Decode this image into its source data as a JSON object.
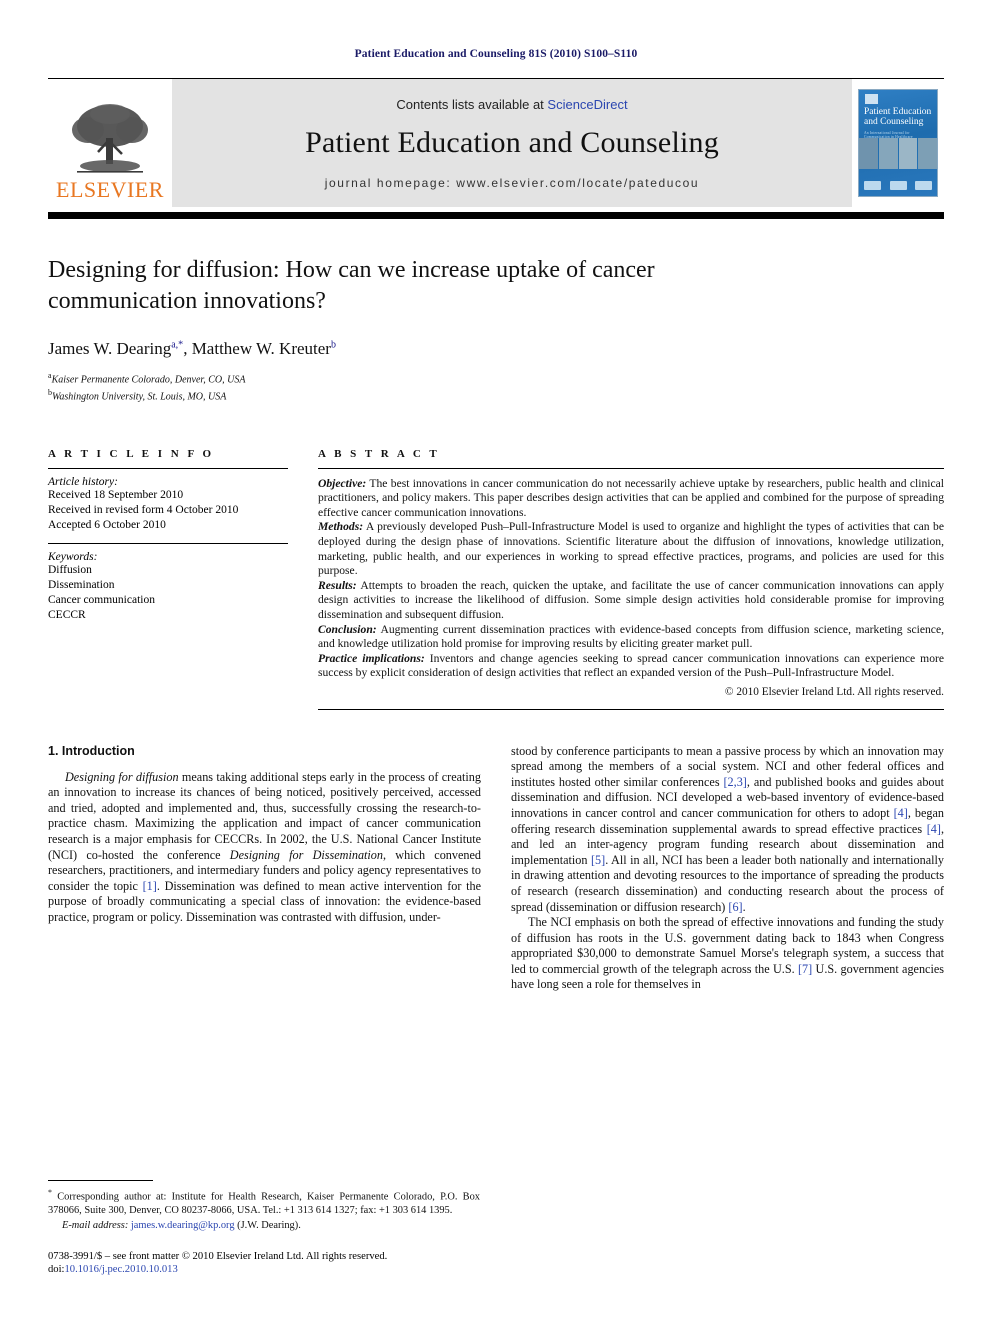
{
  "running_head": "Patient Education and Counseling 81S (2010) S100–S110",
  "masthead": {
    "publisher": "ELSEVIER",
    "contents_prefix": "Contents lists available at ",
    "contents_link": "ScienceDirect",
    "journal_title": "Patient Education and Counseling",
    "homepage": "journal homepage: www.elsevier.com/locate/pateducou",
    "cover": {
      "title_line1": "Patient Education",
      "title_line2": "and Counseling",
      "subtitle": "An International Journal for Communication in Healthcare"
    }
  },
  "article": {
    "title": "Designing for diffusion: How can we increase uptake of cancer communication innovations?",
    "authors": "James W. Dearing, Matthew W. Kreuter",
    "author1_name": "James W. Dearing",
    "author1_marks": "a,*",
    "author2_name": "Matthew W. Kreuter",
    "author2_marks": "b",
    "affiliation_a_mark": "a",
    "affiliation_a": "Kaiser Permanente Colorado, Denver, CO, USA",
    "affiliation_b_mark": "b",
    "affiliation_b": "Washington University, St. Louis, MO, USA"
  },
  "info": {
    "label": "A R T I C L E    I N F O",
    "history_label": "Article history:",
    "received": "Received 18 September 2010",
    "revised": "Received in revised form 4 October 2010",
    "accepted": "Accepted 6 October 2010",
    "keywords_label": "Keywords:",
    "keywords": [
      "Diffusion",
      "Dissemination",
      "Cancer communication",
      "CECCR"
    ]
  },
  "abstract": {
    "label": "A B S T R A C T",
    "objective_label": "Objective:",
    "objective_text": " The best innovations in cancer communication do not necessarily achieve uptake by researchers, public health and clinical practitioners, and policy makers. This paper describes design activities that can be applied and combined for the purpose of spreading effective cancer communication innovations.",
    "methods_label": "Methods:",
    "methods_text": " A previously developed Push–Pull-Infrastructure Model is used to organize and highlight the types of activities that can be deployed during the design phase of innovations. Scientific literature about the diffusion of innovations, knowledge utilization, marketing, public health, and our experiences in working to spread effective practices, programs, and policies are used for this purpose.",
    "results_label": "Results:",
    "results_text": " Attempts to broaden the reach, quicken the uptake, and facilitate the use of cancer communication innovations can apply design activities to increase the likelihood of diffusion. Some simple design activities hold considerable promise for improving dissemination and subsequent diffusion.",
    "conclusion_label": "Conclusion:",
    "conclusion_text": " Augmenting current dissemination practices with evidence-based concepts from diffusion science, marketing science, and knowledge utilization hold promise for improving results by eliciting greater market pull.",
    "practice_label": "Practice implications:",
    "practice_text": " Inventors and change agencies seeking to spread cancer communication innovations can experience more success by explicit consideration of design activities that reflect an expanded version of the Push–Pull-Infrastructure Model.",
    "copyright": "© 2010 Elsevier Ireland Ltd. All rights reserved."
  },
  "body": {
    "section1_heading": "1. Introduction",
    "left_para1_lead": "Designing for diffusion",
    "left_para1_rest": " means taking additional steps early in the process of creating an innovation to increase its chances of being noticed, positively perceived, accessed and tried, adopted and implemented and, thus, successfully crossing the research-to-practice chasm. Maximizing the application and impact of cancer communication research is a major emphasis for CECCRs. In 2002, the U.S. National Cancer Institute (NCI) co-hosted the conference ",
    "left_para1_italic2": "Designing for Dissemination",
    "left_para1_rest2": ", which convened researchers, practitioners, and intermediary funders and policy agency representatives to consider the topic ",
    "left_cite1": "[1]",
    "left_para1_rest3": ". Dissemination was defined to mean active intervention for the purpose of broadly communicating a special class of innovation: the evidence-based practice, program or policy. Dissemination was contrasted with diffusion, under-",
    "right_para1_a": "stood by conference participants to mean a passive process by which an innovation may spread among the members of a social system. NCI and other federal offices and institutes hosted other similar conferences ",
    "right_cite1": "[2,3]",
    "right_para1_b": ", and published books and guides about dissemination and diffusion. NCI developed a web-based inventory of evidence-based innovations in cancer control and cancer communication for others to adopt ",
    "right_cite2": "[4]",
    "right_para1_c": ", began offering research dissemination supplemental awards to spread effective practices ",
    "right_cite3": "[4]",
    "right_para1_d": ", and led an inter-agency program funding research about dissemination and implementation ",
    "right_cite4": "[5]",
    "right_para1_e": ". All in all, NCI has been a leader both nationally and internationally in drawing attention and devoting resources to the importance of spreading the products of research (research dissemination) and conducting research about the process of spread (dissemination or diffusion research) ",
    "right_cite5": "[6]",
    "right_para1_f": ".",
    "right_para2_a": "The NCI emphasis on both the spread of effective innovations and funding the study of diffusion has roots in the U.S. government dating back to 1843 when Congress appropriated $30,000 to demonstrate Samuel Morse's telegraph system, a success that led to commercial growth of the telegraph across the U.S. ",
    "right_cite6": "[7]",
    "right_para2_b": " U.S. government agencies have long seen a role for themselves in"
  },
  "footnotes": {
    "corresponding_mark": "*",
    "corresponding_text": " Corresponding author at: Institute for Health Research, Kaiser Permanente Colorado, P.O. Box 378066, Suite 300, Denver, CO 80237-8066, USA. Tel.: +1 313 614 1327; fax: +1 303 614 1395.",
    "email_label": "E-mail address:",
    "email_address": "james.w.dearing@kp.org",
    "email_suffix": " (J.W. Dearing).",
    "issn_line": "0738-3991/$ – see front matter © 2010 Elsevier Ireland Ltd. All rights reserved.",
    "doi_prefix": "doi:",
    "doi_value": "10.1016/j.pec.2010.10.013"
  },
  "colors": {
    "link": "#2b46b0",
    "running_head": "#1a1a66",
    "elsevier_orange": "#e87722",
    "masthead_gray": "#e3e3e3"
  }
}
